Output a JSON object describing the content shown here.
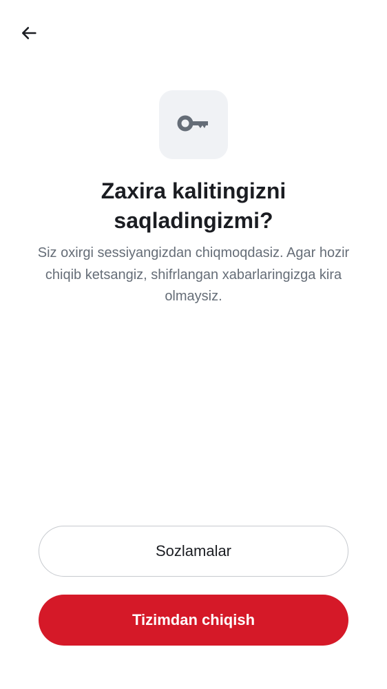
{
  "header": {
    "back_icon": "arrow-left-icon"
  },
  "hero": {
    "icon": "key-icon",
    "icon_tile_color": "#f0f2f5",
    "icon_color": "#656d77"
  },
  "title": "Zaxira kalitingizni saqladingizmi?",
  "description": "Siz oxirgi sessiyangizdan chiqmoqdasiz. Agar hozir chiqib ketsangiz, shifrlangan xabarlaringizga kira olmaysiz.",
  "actions": {
    "settings_label": "Sozlamalar",
    "logout_label": "Tizimdan chiqish",
    "logout_color": "#d51928"
  }
}
